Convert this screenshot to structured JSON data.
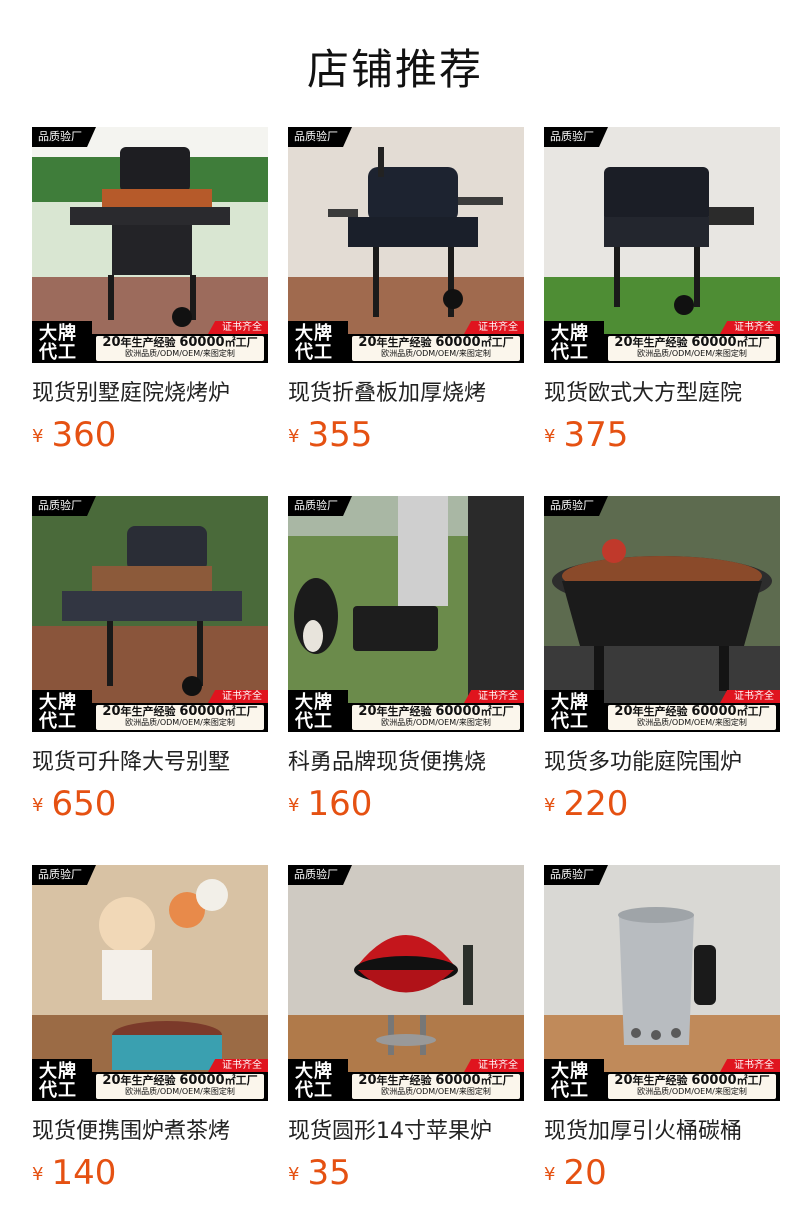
{
  "page": {
    "title": "店铺推荐"
  },
  "badges": {
    "quality": "品质验厂",
    "cert": "证书齐全",
    "brand_line1": "大牌",
    "brand_line2": "代工",
    "years": "20",
    "years_text": "年生产经验",
    "area": "60000",
    "area_text": "㎡工厂",
    "services": "欧洲品质/ODM/OEM/来图定制"
  },
  "currency": "¥",
  "colors": {
    "price": "#e55112",
    "cert_red": "#e0141e"
  },
  "products": [
    {
      "name": "现货别墅庭院烧烤炉",
      "price": "360",
      "image": "charcoal-cart-grill-fence"
    },
    {
      "name": "现货折叠板加厚烧烤",
      "price": "355",
      "image": "black-cart-grill-brick-wall"
    },
    {
      "name": "现货欧式大方型庭院",
      "price": "375",
      "image": "square-cart-grill-lawn"
    },
    {
      "name": "现货可升降大号别墅",
      "price": "650",
      "image": "large-double-grill-deck"
    },
    {
      "name": "科勇品牌现货便携烧",
      "price": "160",
      "image": "portable-grill-dog"
    },
    {
      "name": "现货多功能庭院围炉",
      "price": "220",
      "image": "fire-pit-grill"
    },
    {
      "name": "现货便携围炉煮茶烤",
      "price": "140",
      "image": "tabletop-grill-camping"
    },
    {
      "name": "现货圆形14寸苹果炉",
      "price": "35",
      "image": "red-kettle-grill"
    },
    {
      "name": "现货加厚引火桶碳桶",
      "price": "20",
      "image": "chimney-starter"
    }
  ]
}
